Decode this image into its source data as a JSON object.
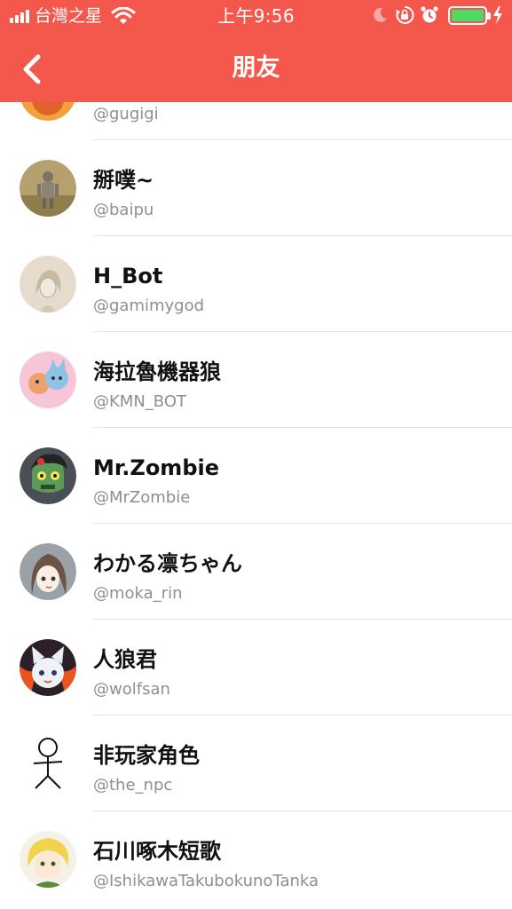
{
  "status_bar": {
    "carrier": "台灣之星",
    "time": "上午9:56",
    "battery_level": 1.0
  },
  "nav": {
    "title": "朋友",
    "back_icon": "chevron-left-icon"
  },
  "friends": [
    {
      "name": "",
      "handle": "@gugigi",
      "avatar": "orange-character-avatar"
    },
    {
      "name": "掰噗~",
      "handle": "@baipu",
      "avatar": "knight-armor-avatar"
    },
    {
      "name": "H_Bot",
      "handle": "@gamimygod",
      "avatar": "sketch-portrait-avatar"
    },
    {
      "name": "海拉魯機器狼",
      "handle": "@KMN_BOT",
      "avatar": "wolf-cartoon-avatar"
    },
    {
      "name": "Mr.Zombie",
      "handle": "@MrZombie",
      "avatar": "zombie-avatar"
    },
    {
      "name": "わかる凛ちゃん",
      "handle": "@moka_rin",
      "avatar": "anime-girl-avatar"
    },
    {
      "name": "人狼君",
      "handle": "@wolfsan",
      "avatar": "white-wolf-avatar"
    },
    {
      "name": "非玩家角色",
      "handle": "@the_npc",
      "avatar": "stick-figure-avatar"
    },
    {
      "name": "石川啄木短歌",
      "handle": "@IshikawaTakubokunoTanka",
      "avatar": "blond-boy-avatar"
    }
  ],
  "colors": {
    "header_bg": "#f4574c",
    "battery_fill": "#4cd964",
    "handle_text": "#8e8e93"
  }
}
